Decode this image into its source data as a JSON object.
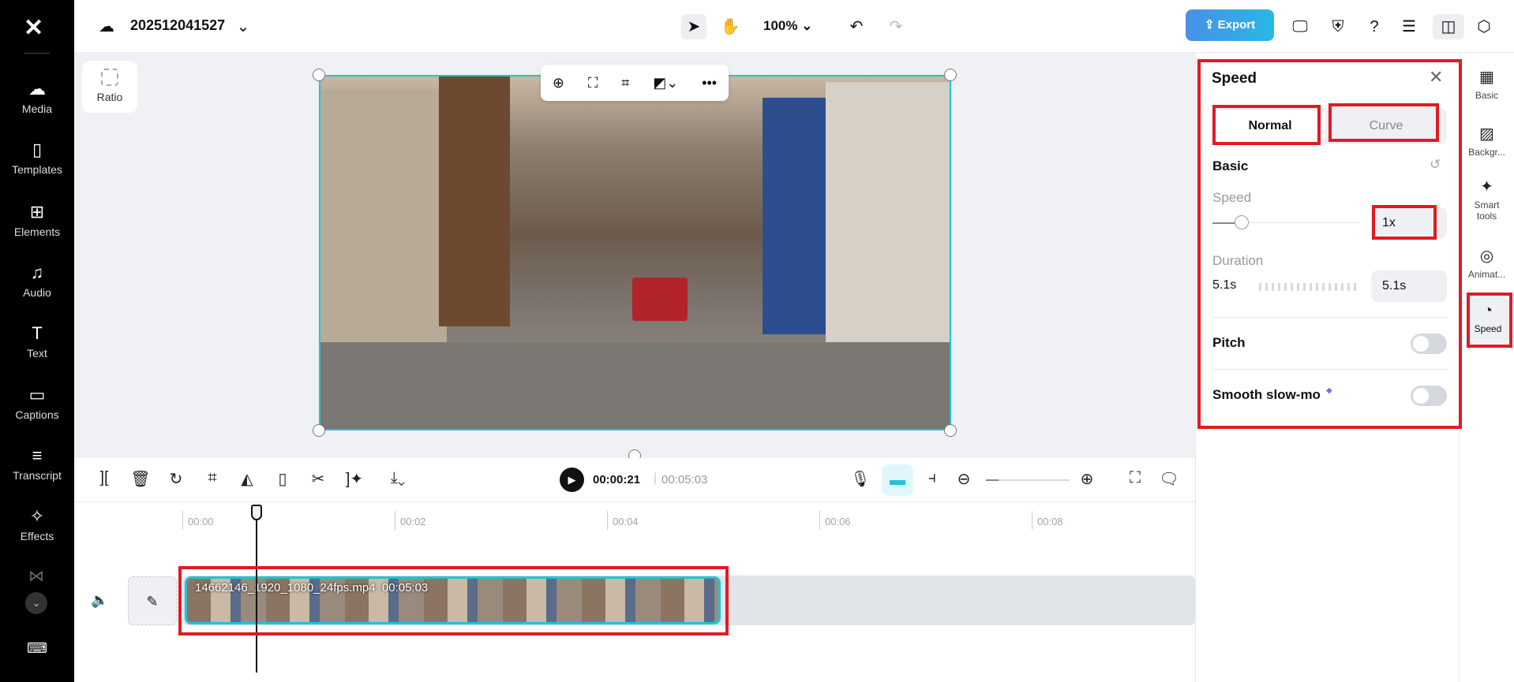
{
  "sidebar": {
    "items": [
      {
        "label": "Media",
        "icon": "cloud-upload-icon"
      },
      {
        "label": "Templates",
        "icon": "templates-icon"
      },
      {
        "label": "Elements",
        "icon": "elements-icon"
      },
      {
        "label": "Audio",
        "icon": "music-note-icon"
      },
      {
        "label": "Text",
        "icon": "text-icon"
      },
      {
        "label": "Captions",
        "icon": "captions-icon"
      },
      {
        "label": "Transcript",
        "icon": "transcript-icon"
      },
      {
        "label": "Effects",
        "icon": "effects-icon"
      }
    ]
  },
  "header": {
    "project_name": "202512041527",
    "zoom": "100%",
    "export_label": "Export"
  },
  "canvas": {
    "ratio_label": "Ratio"
  },
  "timeline": {
    "current_time": "00:00:21",
    "total_time": "00:05:03",
    "ticks": [
      "00:00",
      "00:02",
      "00:04",
      "00:06",
      "00:08"
    ],
    "clip_name": "14662146_1920_1080_24fps.mp4",
    "clip_duration": "00:05:03"
  },
  "speed_panel": {
    "title": "Speed",
    "tabs": [
      "Normal",
      "Curve"
    ],
    "section": "Basic",
    "speed_label": "Speed",
    "speed_value": "1x",
    "duration_label": "Duration",
    "duration_from": "5.1s",
    "duration_to": "5.1s",
    "pitch_label": "Pitch",
    "pitch_on": false,
    "smooth_label": "Smooth slow-mo",
    "smooth_on": false
  },
  "right_bar": {
    "items": [
      {
        "label": "Basic"
      },
      {
        "label": "Backgr..."
      },
      {
        "label": "Smart tools"
      },
      {
        "label": "Animat..."
      },
      {
        "label": "Speed"
      }
    ]
  },
  "colors": {
    "accent": "#22c3d6",
    "export_from": "#4a8fe7",
    "export_to": "#28b8e3",
    "annotation": "#e01b22"
  }
}
